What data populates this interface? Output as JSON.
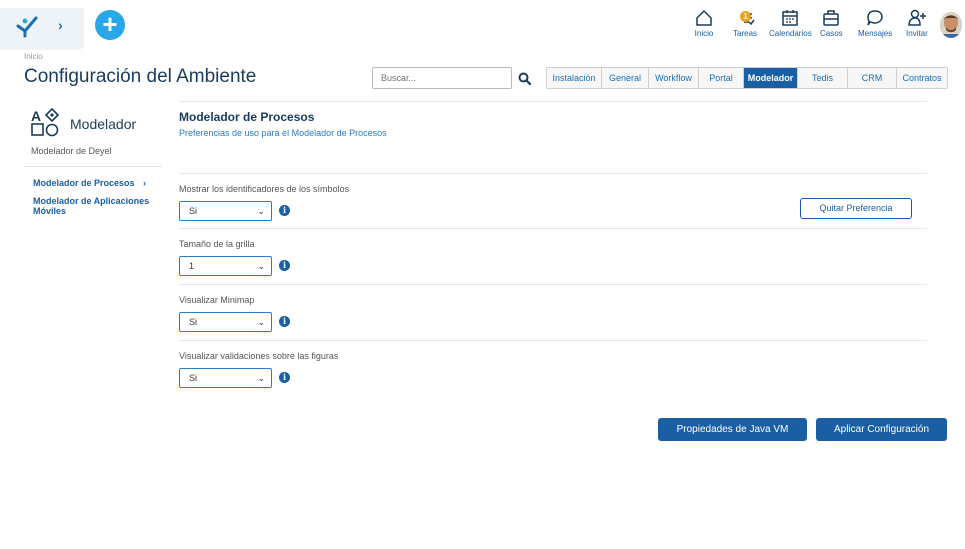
{
  "nav": {
    "items": [
      {
        "label": "Inicio",
        "icon": "home-icon"
      },
      {
        "label": "Tareas",
        "icon": "tasks-icon",
        "badge": "1"
      },
      {
        "label": "Calendarios",
        "icon": "calendar-icon"
      },
      {
        "label": "Casos",
        "icon": "briefcase-icon"
      },
      {
        "label": "Mensajes",
        "icon": "chat-icon"
      },
      {
        "label": "Invitar",
        "icon": "add-user-icon"
      }
    ],
    "add_label": "+",
    "expand_label": "›"
  },
  "breadcrumb": "Inicio",
  "page_title": "Configuración del Ambiente",
  "search": {
    "placeholder": "Buscar..."
  },
  "tabs": [
    {
      "label": "Instalación",
      "active": false
    },
    {
      "label": "General",
      "active": false
    },
    {
      "label": "Workflow",
      "active": false
    },
    {
      "label": "Portal",
      "active": false
    },
    {
      "label": "Modelador",
      "active": true
    },
    {
      "label": "Tedis",
      "active": false
    },
    {
      "label": "CRM",
      "active": false
    },
    {
      "label": "Contratos",
      "active": false
    }
  ],
  "sidebar": {
    "title": "Modelador",
    "subtitle": "Modelador de Deyel",
    "items": [
      {
        "label": "Modelador de Procesos",
        "chevron": "›"
      },
      {
        "label": "Modelador de Aplicaciones Móviles"
      }
    ]
  },
  "section": {
    "title": "Modelador de Procesos",
    "subtitle": "Preferencias de uso para el Modelador de Procesos"
  },
  "preferences": [
    {
      "label": "Mostrar los identificadores de los símbolos",
      "value": "Si"
    },
    {
      "label": "Tamaño de la grilla",
      "value": "1"
    },
    {
      "label": "Visualizar Minimap",
      "value": "Si"
    },
    {
      "label": "Visualizar validaciones sobre las figuras",
      "value": "Si"
    }
  ],
  "buttons": {
    "remove_preference": "Quitar Preferencia",
    "java_vm": "Propiedades de Java VM",
    "apply": "Aplicar Configuración"
  },
  "colors": {
    "accent": "#1a5fa3",
    "add": "#2aa7e8",
    "badge": "#f0a020"
  }
}
